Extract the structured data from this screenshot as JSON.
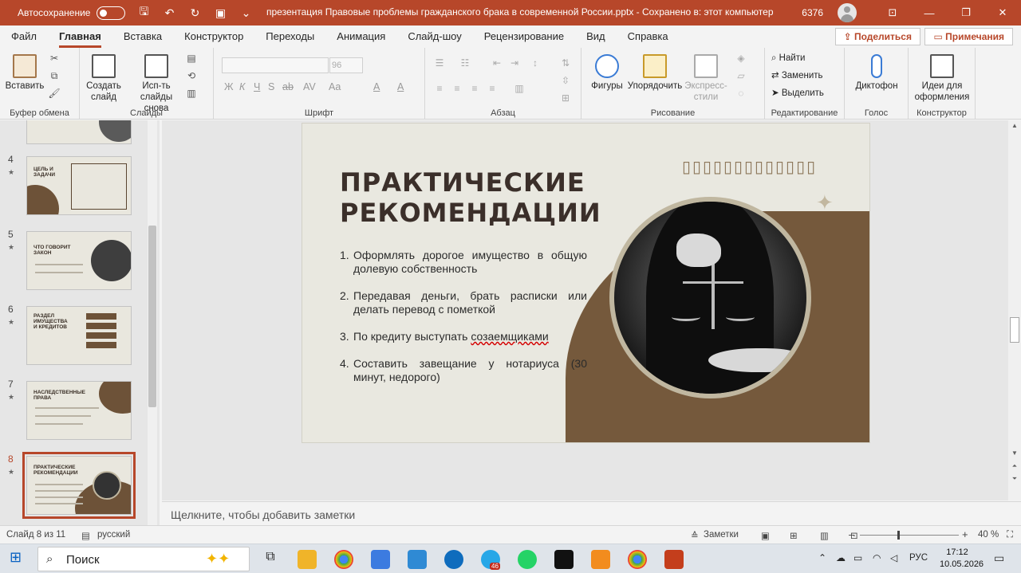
{
  "titlebar": {
    "autosave_label": "Автосохранение",
    "document_title": "презентация Правовые проблемы гражданского брака в современной России.pptx  -  Сохранено в: этот компьютер",
    "user_number": "6376"
  },
  "menu": {
    "tabs": [
      "Файл",
      "Главная",
      "Вставка",
      "Конструктор",
      "Переходы",
      "Анимация",
      "Слайд-шоу",
      "Рецензирование",
      "Вид",
      "Справка"
    ],
    "share_label": "Поделиться",
    "comments_label": "Примечания"
  },
  "ribbon": {
    "groups": {
      "clipboard": "Буфер обмена",
      "slides": "Слайды",
      "font": "Шрифт",
      "paragraph": "Абзац",
      "drawing": "Рисование",
      "editing": "Редактирование",
      "voice": "Голос",
      "designer": "Конструктор"
    },
    "buttons": {
      "paste": "Вставить",
      "new_slide_1": "Создать",
      "new_slide_2": "слайд",
      "reuse_1": "Исп-ть",
      "reuse_2": "слайды снова",
      "font_size": "96",
      "shapes": "Фигуры",
      "arrange": "Упорядочить",
      "quick_styles_1": "Экспресс-",
      "quick_styles_2": "стили",
      "find": "Найти",
      "replace": "Заменить",
      "select": "Выделить",
      "dictate": "Диктофон",
      "ideas_1": "Идеи для",
      "ideas_2": "оформления"
    },
    "font_format_glyphs": [
      "Ж",
      "К",
      "Ч",
      "S",
      "ab",
      "AV",
      "Aa",
      "A",
      "A"
    ]
  },
  "thumbnails": [
    {
      "num": "4",
      "title": "ЦЕЛЬ И\nЗАДАЧИ"
    },
    {
      "num": "5",
      "title": "ЧТО ГОВОРИТ\nЗАКОН"
    },
    {
      "num": "6",
      "title": "РАЗДЕЛ\nИМУЩЕСТВА\nИ КРЕДИТОВ"
    },
    {
      "num": "7",
      "title": "НАСЛЕДСТВЕННЫЕ\nПРАВА"
    },
    {
      "num": "8",
      "title": "ПРАКТИЧЕСКИЕ\nРЕКОМЕНДАЦИИ"
    }
  ],
  "slide": {
    "title_line1": "ПРАКТИЧЕСКИЕ",
    "title_line2": "РЕКОМЕНДАЦИИ",
    "placeholder_glyphs": "▯▯▯▯▯▯▯▯▯▯▯▯▯",
    "items": [
      {
        "n": "1.",
        "text": "Оформлять дорогое имущество в общую долевую собственность"
      },
      {
        "n": "2.",
        "text": "Передавая деньги, брать расписки или делать перевод с пометкой"
      },
      {
        "n": "3.",
        "text_before": "По кредиту выступать ",
        "text_underlined": "созаемщиками"
      },
      {
        "n": "4.",
        "text": "Составить завещание у нотариуса (30 минут, недорого)"
      }
    ]
  },
  "notes_placeholder": "Щелкните, чтобы добавить заметки",
  "status": {
    "slide_counter": "Слайд 8 из 11",
    "language": "русский",
    "notes_label": "Заметки",
    "zoom": "40 %"
  },
  "taskbar": {
    "search_label": "Поиск",
    "language": "РУС",
    "time": "17:12",
    "date": "10.05.2026",
    "telegram_badge": "46"
  },
  "colors": {
    "accent": "#b7472a",
    "slide_bg": "#e9e8e0",
    "slide_brown": "#75593c",
    "title_text": "#3b2f2a"
  }
}
